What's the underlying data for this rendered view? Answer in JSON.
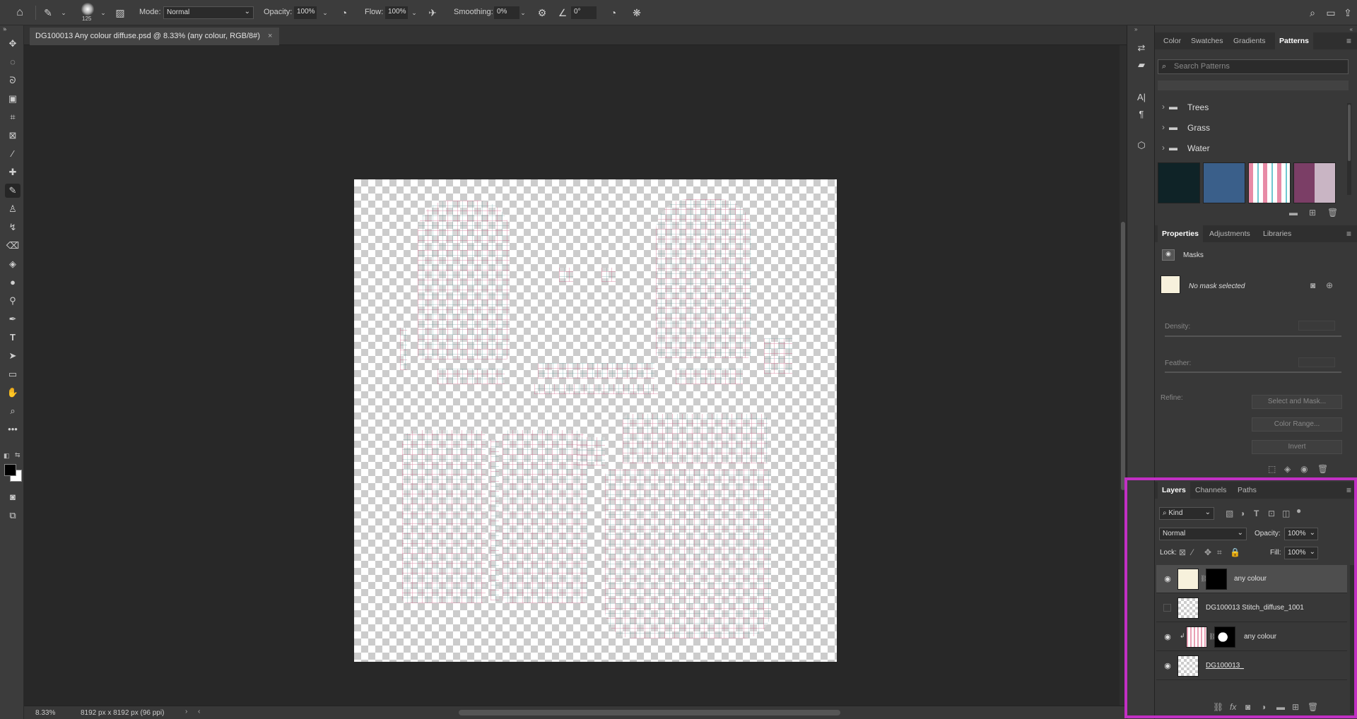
{
  "options_bar": {
    "brush_size": "125",
    "mode_label": "Mode:",
    "mode_value": "Normal",
    "opacity_label": "Opacity:",
    "opacity_value": "100%",
    "flow_label": "Flow:",
    "flow_value": "100%",
    "smoothing_label": "Smoothing:",
    "smoothing_value": "0%",
    "angle_value": "0°"
  },
  "document": {
    "tab_title": "DG100013 Any colour diffuse.psd @ 8.33% (any colour, RGB/8#)",
    "zoom": "8.33%",
    "dimensions": "8192 px x 8192 px (96 ppi)"
  },
  "patterns_panel": {
    "tabs": [
      "Color",
      "Swatches",
      "Gradients",
      "Patterns"
    ],
    "active_tab": "Patterns",
    "search_placeholder": "Search Patterns",
    "folders": [
      "Trees",
      "Grass",
      "Water"
    ],
    "swatch_colors": [
      "#0f2327",
      "#3a5f8a",
      "#e88aa6",
      "#7b3e66"
    ]
  },
  "properties_panel": {
    "tabs": [
      "Properties",
      "Adjustments",
      "Libraries"
    ],
    "section": "Masks",
    "no_mask": "No mask selected",
    "density_label": "Density:",
    "feather_label": "Feather:",
    "refine_label": "Refine:",
    "buttons": [
      "Select and Mask...",
      "Color Range...",
      "Invert"
    ]
  },
  "layers_panel": {
    "tabs": [
      "Layers",
      "Channels",
      "Paths"
    ],
    "kind_label": "Kind",
    "blend_mode": "Normal",
    "opacity_label": "Opacity:",
    "opacity_value": "100%",
    "lock_label": "Lock:",
    "fill_label": "Fill:",
    "fill_value": "100%",
    "layers": [
      {
        "name": "any colour",
        "visible": true,
        "selected": true
      },
      {
        "name": "DG100013 Stitch_diffuse_1001",
        "visible": false,
        "selected": false
      },
      {
        "name": "any colour",
        "visible": true,
        "selected": false
      },
      {
        "name": "DG100013_",
        "visible": true,
        "selected": false
      }
    ],
    "highlight_color": "#c22fc4"
  }
}
